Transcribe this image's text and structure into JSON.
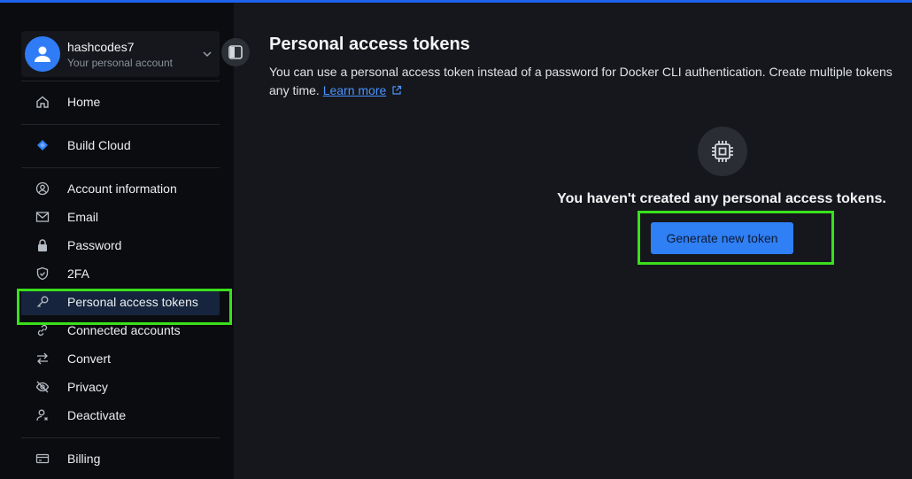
{
  "account": {
    "name": "hashcodes7",
    "subtitle": "Your personal account"
  },
  "sidebar": {
    "items": [
      {
        "label": "Home",
        "icon": "home-icon"
      },
      {
        "label": "Build Cloud",
        "icon": "build-cloud-icon"
      },
      {
        "label": "Account information",
        "icon": "account-circle-icon"
      },
      {
        "label": "Email",
        "icon": "mail-icon"
      },
      {
        "label": "Password",
        "icon": "lock-icon"
      },
      {
        "label": "2FA",
        "icon": "shield-check-icon"
      },
      {
        "label": "Personal access tokens",
        "icon": "key-icon",
        "active": true
      },
      {
        "label": "Connected accounts",
        "icon": "link-icon"
      },
      {
        "label": "Convert",
        "icon": "swap-arrows-icon"
      },
      {
        "label": "Privacy",
        "icon": "eye-off-icon"
      },
      {
        "label": "Deactivate",
        "icon": "user-remove-icon"
      },
      {
        "label": "Billing",
        "icon": "credit-card-icon"
      }
    ]
  },
  "main": {
    "title": "Personal access tokens",
    "description_line1": "You can use a personal access token instead of a password for Docker CLI authentication. Create multiple tokens",
    "description_line2": "any time.",
    "learn_more": "Learn more",
    "empty_state": "You haven't created any personal access tokens.",
    "generate_button": "Generate new token"
  },
  "colors": {
    "accent": "#1d63ed",
    "button": "#2f7ff5",
    "highlight": "#3ae01c",
    "sidebar_bg": "#0b0c0f",
    "main_bg": "#15171c"
  }
}
